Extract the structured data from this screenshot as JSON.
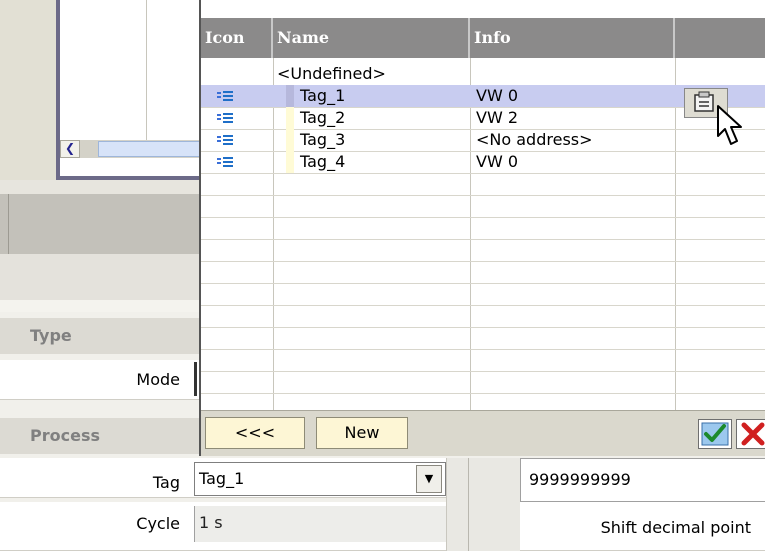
{
  "tag_browser": {
    "columns": {
      "icon": "Icon",
      "name": "Name",
      "info": "Info",
      "extra": ""
    },
    "undefined_entry": "<Undefined>",
    "rows": [
      {
        "name": "Tag_1",
        "info": "VW 0",
        "selected": true,
        "icon": "tag-list-icon"
      },
      {
        "name": "Tag_2",
        "info": "VW 2",
        "selected": false,
        "icon": "tag-list-icon"
      },
      {
        "name": "Tag_3",
        "info": "<No address>",
        "selected": false,
        "icon": "tag-list-icon"
      },
      {
        "name": "Tag_4",
        "info": "VW 0",
        "selected": false,
        "icon": "tag-list-icon"
      }
    ],
    "back_button": "<<<",
    "new_button": "New",
    "edit_icon": "tag-properties-icon",
    "ok_icon": "checkmark-icon",
    "cancel_icon": "close-icon"
  },
  "properties": {
    "type_section": "Type",
    "mode_label": "Mode",
    "process_section": "Process",
    "tag_label": "Tag",
    "tag_value": "Tag_1",
    "cycle_label": "Cycle",
    "cycle_value": "1 s",
    "value_field": "9999999999",
    "shift_label": "Shift decimal point"
  },
  "colors": {
    "header_bg": "#8b8a8a",
    "selection_bg": "#c8ccf0",
    "button_bg": "#fdf6d5",
    "section_text": "#808080"
  }
}
